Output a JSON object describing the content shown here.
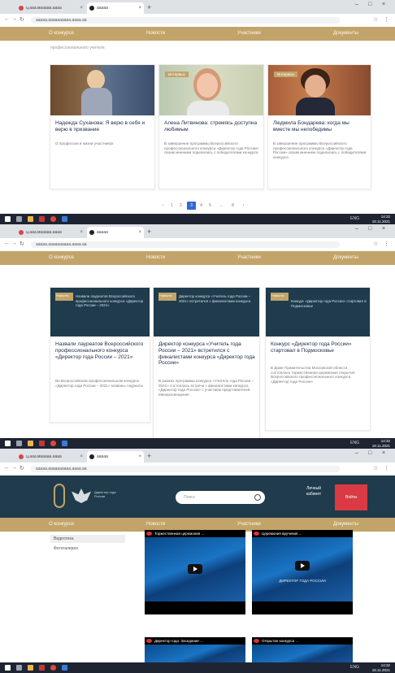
{
  "browser": {
    "tabs": [
      {
        "title": "ц.ааа.мааааа.аааа",
        "active": false
      },
      {
        "title": "ааааа",
        "active": true
      }
    ],
    "new_tab": "+",
    "url": "ааааа.аааааааааа.аааа.аа",
    "window_controls": [
      "–",
      "□",
      "×"
    ]
  },
  "menu": {
    "items": [
      "О конкурсе",
      "Новости",
      "Участники",
      "Документы"
    ]
  },
  "shot1": {
    "intro_text": "профессионального учителя",
    "cards": [
      {
        "title": "Надежда Суханова: Я верю в себя и верю в призвание",
        "text": "О профессии и жизни участников"
      },
      {
        "title": "Алена Литвинова: стремясь доступна любимым",
        "text": "В завершение программы Всероссийского профессионального конкурса «Директор года России» своим мнением поделились с победителями конкурса"
      },
      {
        "title": "Людмила Бондарева: когда мы вместе мы непобедимы",
        "text": "В завершение программы Всероссийского профессионального конкурса «Директор года России» своим мнением поделились с победителями конкурса"
      }
    ],
    "pages": [
      "‹",
      "1",
      "2",
      "3",
      "4",
      "5",
      "...",
      "8",
      "›"
    ],
    "active_page": "3"
  },
  "shot2": {
    "cards": [
      {
        "tag": "Новости",
        "img_text": "Назвали лауреатов Всероссийского профессионального конкурса «Директор года России – 2021»",
        "title": "Назвали лауреатов Всероссийского профессионального конкурса «Директор года России – 2021»",
        "text": "Во Всероссийском профессиональном конкурсе «Директор года России – 2021» названы лауреаты"
      },
      {
        "tag": "Новости",
        "img_text": "Директор конкурса «Учитель года России – 2021» встретился с финалистами конкурса",
        "title": "Директор конкурса «Учитель года России – 2021» встретился с финалистами конкурса «Директор года России»",
        "text": "В рамках программы конкурса «Учитель года России – 2021» состоялась встреча с финалистами конкурса «Директор года России» с участием представителей Минпросвещения"
      },
      {
        "tag": "Новости",
        "img_text": "Конкурс «Директор года России» стартовал в Подмосковье",
        "title": "Конкурс «Директор года России» стартовал в Подмосковье",
        "text": "В Доме Правительства Московской области состоялась торжественная церемония открытия Всероссийского профессионального конкурса «Директор года России»"
      }
    ]
  },
  "shot3": {
    "logo_text": "Директор года России",
    "search_placeholder": "Поиск",
    "login": "Личный кабинет",
    "red_button": "Войти",
    "side_items": [
      "Видеотека",
      "Фотогалерея"
    ],
    "videos": [
      {
        "title": "Торжественная церемония ...",
        "caption": ""
      },
      {
        "title": "Церемония вручения ...",
        "caption": "ДИРЕКТОР ГОДА РОССИИ"
      },
      {
        "title": "Директор года: Заседание ...",
        "caption": ""
      },
      {
        "title": "Открытие конкурса ...",
        "caption": ""
      }
    ]
  },
  "taskbar": {
    "tray": "ENG",
    "time": "14:32",
    "date": "18.11.2021"
  },
  "colors": {
    "gold": "#c2a46a",
    "navy": "#1f3b4c",
    "red": "#d93a44",
    "blue_active": "#2f6bd6"
  }
}
